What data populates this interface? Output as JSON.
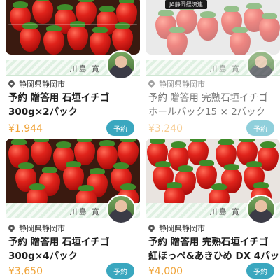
{
  "listings": [
    {
      "seller": "川島 寛",
      "location": "静岡県静岡市",
      "title_line1": "予約 贈答用 石垣イチゴ",
      "title_line2": "300g×2パック",
      "price": "¥1,944",
      "reserve_label": "予約",
      "photo": "strawberry-tray-photo",
      "faded": false
    },
    {
      "seller": "川島 寛",
      "location": "静岡県静岡市",
      "title_line1": "予約 贈答用 完熟石垣イチゴ",
      "title_line2": "ホールパック15 × 2パック",
      "price": "¥3,240",
      "reserve_label": "予約",
      "photo": "strawberry-box-photo",
      "box_label": "JA静岡経済連",
      "faded": true
    },
    {
      "seller": "川島 寛",
      "location": "静岡県静岡市",
      "title_line1": "予約 贈答用 石垣イチゴ",
      "title_line2": "300g×4パック",
      "price": "¥3,650",
      "reserve_label": "予約",
      "photo": "strawberry-tray-photo",
      "faded": false
    },
    {
      "seller": "川島 寛",
      "location": "静岡県静岡市",
      "title_line1": "予約 贈答用 完熟石垣イチゴ",
      "title_line2": "紅ほっぺ&あきひめ DX 4パッ",
      "price": "¥4,000",
      "reserve_label": "予約",
      "photo": "strawberry-pack-photo",
      "faded": false
    }
  ],
  "colors": {
    "price": "#f0a43a",
    "button": "#3aa7bf",
    "seller_band": "#dff0e2"
  }
}
